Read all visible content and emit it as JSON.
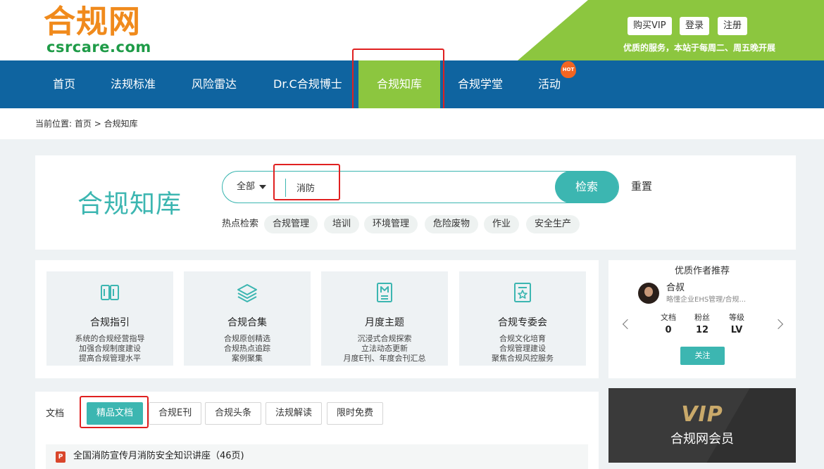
{
  "header": {
    "logo_cn": "合规网",
    "logo_en": "csrcare.com",
    "buy_vip": "购买VIP",
    "login": "登录",
    "register": "注册",
    "marquee": "更优质的服务，本站于每周二、周五晚开展"
  },
  "nav": {
    "items": [
      "首页",
      "法规标准",
      "风险雷达",
      "Dr.C合规博士",
      "合规知库",
      "合规学堂",
      "活动"
    ],
    "active": "合规知库",
    "hot_badge": "HOT"
  },
  "breadcrumb": {
    "label": "当前位置:",
    "home": "首页",
    "sep": ">",
    "current": "合规知库"
  },
  "search": {
    "title": "合规知库",
    "scope": "全部",
    "query": "消防",
    "search_button": "检索",
    "reset_button": "重置",
    "hot_label": "热点检索",
    "hot_tags": [
      "合规管理",
      "培训",
      "环境管理",
      "危险废物",
      "作业",
      "安全生产"
    ]
  },
  "features": [
    {
      "title": "合规指引",
      "icon": "book-icon",
      "lines": [
        "系统的合规经营指导",
        "加强合规制度建设",
        "提高合规管理水平"
      ]
    },
    {
      "title": "合规合集",
      "icon": "layers-icon",
      "lines": [
        "合规原创精选",
        "合规热点追踪",
        "案例聚集"
      ]
    },
    {
      "title": "月度主题",
      "icon": "monthly-doc-icon",
      "lines": [
        "沉浸式合规探索",
        "立法动态更新",
        "月度E刊、年度会刊汇总"
      ]
    },
    {
      "title": "合规专委会",
      "icon": "certificate-icon",
      "lines": [
        "合规文化培育",
        "合规管理建设",
        "聚焦合规风控服务"
      ]
    }
  ],
  "author": {
    "heading": "优质作者推荐",
    "name": "合叔",
    "desc": "略懂企业EHS管理/合规...",
    "stats": [
      {
        "label": "文档",
        "value": "0"
      },
      {
        "label": "粉丝",
        "value": "12"
      },
      {
        "label": "等级",
        "value": "LV"
      }
    ],
    "follow_button": "关注"
  },
  "docs": {
    "label": "文档",
    "tabs": [
      "精品文档",
      "合规E刊",
      "合规头条",
      "法规解读",
      "限时免费"
    ],
    "active_tab": "精品文档",
    "items": [
      {
        "title": "全国消防宣传月消防安全知识讲座（46页)",
        "file_icon": "P"
      }
    ]
  },
  "vip_banner": {
    "logo": "VIP",
    "text": "合规网会员"
  },
  "colors": {
    "nav_blue": "#0f64a0",
    "brand_green": "#8cc63f",
    "teal": "#3cb6b1",
    "logo_orange": "#f08a1c",
    "highlight_red": "#e02020"
  }
}
